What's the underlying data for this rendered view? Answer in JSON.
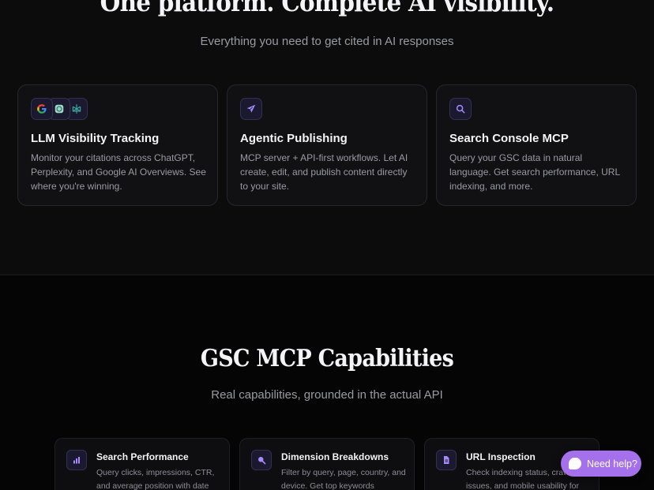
{
  "hero": {
    "title": "One platform. Complete AI visibility.",
    "subtitle": "Everything you need to get cited in AI responses"
  },
  "features": [
    {
      "title": "LLM Visibility Tracking",
      "description": "Monitor your citations across ChatGPT, Perplexity, and Google AI Overviews. See where you're winning.",
      "icons": [
        "google-icon",
        "chatgpt-icon",
        "perplexity-icon"
      ]
    },
    {
      "title": "Agentic Publishing",
      "description": "MCP server + API-first workflows. Let AI create, edit, and publish content directly to your site.",
      "icon": "send-icon"
    },
    {
      "title": "Search Console MCP",
      "description": "Query your GSC data in natural language. Get search performance, URL indexing, and more.",
      "icon": "search-icon"
    }
  ],
  "capabilities_section": {
    "title": "GSC MCP Capabilities",
    "subtitle": "Real capabilities, grounded in the actual API"
  },
  "capabilities": [
    {
      "title": "Search Performance",
      "description": "Query clicks, impressions, CTR, and average position with date",
      "icon": "bar-chart-icon"
    },
    {
      "title": "Dimension Breakdowns",
      "description": "Filter by query, page, country, and device. Get top keywords",
      "icon": "magnifier-icon"
    },
    {
      "title": "URL Inspection",
      "description": "Check indexing status, crawl issues, and mobile usability for",
      "icon": "document-icon"
    }
  ],
  "help": {
    "label": "Need help?"
  },
  "colors": {
    "accent": "#a470ec",
    "background": "#0c0c0d",
    "card": "#111113",
    "icon_tint": "#a78bfa"
  }
}
